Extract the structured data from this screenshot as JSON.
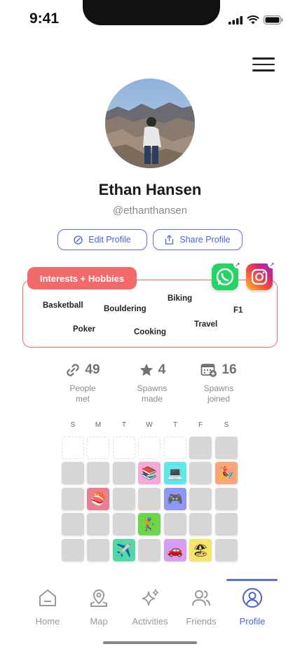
{
  "status_bar": {
    "time": "9:41"
  },
  "profile": {
    "name": "Ethan Hansen",
    "handle": "@ethanthansen",
    "edit_button": "Edit Profile",
    "share_button": "Share Profile"
  },
  "interests": {
    "title": "Interests + Hobbies",
    "items": [
      "Basketball",
      "Bouldering",
      "Biking",
      "F1",
      "Poker",
      "Cooking",
      "Travel"
    ]
  },
  "socials": [
    {
      "name": "whatsapp",
      "icon": "whatsapp-icon"
    },
    {
      "name": "instagram",
      "icon": "instagram-icon"
    }
  ],
  "stats": [
    {
      "value": "49",
      "label": "People met",
      "icon": "link-icon"
    },
    {
      "value": "4",
      "label": "Spawns made",
      "icon": "star-icon"
    },
    {
      "value": "16",
      "label": "Spawns joined",
      "icon": "calendar-add-icon"
    }
  ],
  "calendar": {
    "weekdays": [
      "S",
      "M",
      "T",
      "W",
      "T",
      "F",
      "S"
    ],
    "cells": [
      [
        "empty",
        "empty",
        "empty",
        "empty",
        "empty",
        "filled",
        "filled"
      ],
      [
        "filled",
        "filled",
        "filled",
        "books-laptop",
        "laptop",
        "filled",
        "party"
      ],
      [
        "filled",
        "sushi",
        "filled",
        "filled",
        "gamepad",
        "filled",
        "filled"
      ],
      [
        "filled",
        "filled",
        "filled",
        "golf",
        "filled",
        "filled",
        "filled"
      ],
      [
        "filled",
        "filled",
        "plane",
        "filled",
        "car",
        "beach",
        "filled"
      ]
    ],
    "emoji": {
      "books-laptop": "📚",
      "laptop": "💻",
      "party": "🎉",
      "sushi": "🍣",
      "gamepad": "🎮",
      "golf": "🏌",
      "plane": "✈️",
      "car": "🚗",
      "beach": "🏖"
    },
    "colors": {
      "books-laptop": "#f7a9d6",
      "laptop": "#5fe8e8",
      "party": "#f7a77a",
      "sushi": "#e87f8f",
      "gamepad": "#8f97f5",
      "golf": "#6cd64a",
      "plane": "#52d9a6",
      "car": "#d59ef2",
      "beach": "#f7e46a"
    }
  },
  "tabs": [
    {
      "label": "Home",
      "icon": "home-icon"
    },
    {
      "label": "Map",
      "icon": "map-pin-icon"
    },
    {
      "label": "Activities",
      "icon": "sparkles-icon"
    },
    {
      "label": "Friends",
      "icon": "friends-icon"
    },
    {
      "label": "Profile",
      "icon": "profile-icon",
      "active": true
    }
  ]
}
